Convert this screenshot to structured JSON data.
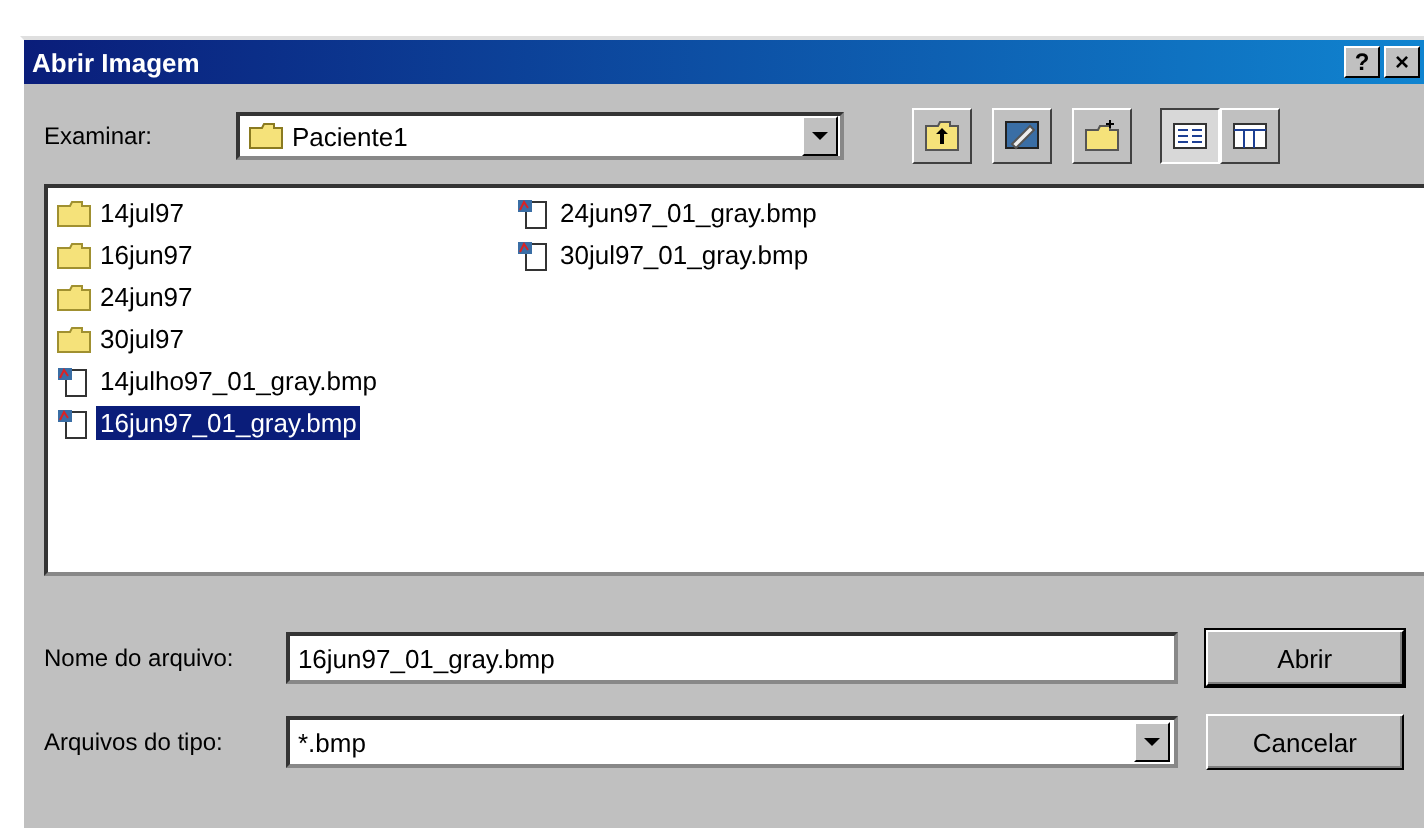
{
  "window": {
    "title": "Abrir Imagem",
    "help_button": "?",
    "close_button": "×"
  },
  "look_in": {
    "label": "Examinar:",
    "value": "Paciente1"
  },
  "toolbar": [
    {
      "kind": "up"
    },
    {
      "kind": "desktop"
    },
    {
      "kind": "newfolder"
    },
    {
      "kind": "list",
      "selected": true
    },
    {
      "kind": "details",
      "selected": false
    }
  ],
  "files": [
    [
      {
        "kind": "folder",
        "name": "14jul97",
        "selected": false
      },
      {
        "kind": "folder",
        "name": "16jun97",
        "selected": false
      },
      {
        "kind": "folder",
        "name": "24jun97",
        "selected": false
      },
      {
        "kind": "folder",
        "name": "30jul97",
        "selected": false
      },
      {
        "kind": "bitmap",
        "name": "14julho97_01_gray.bmp",
        "selected": false
      },
      {
        "kind": "bitmap",
        "name": "16jun97_01_gray.bmp",
        "selected": true
      }
    ],
    [
      {
        "kind": "bitmap",
        "name": "24jun97_01_gray.bmp",
        "selected": false
      },
      {
        "kind": "bitmap",
        "name": "30jul97_01_gray.bmp",
        "selected": false
      }
    ]
  ],
  "file_name": {
    "label": "Nome do arquivo:",
    "value": "16jun97_01_gray.bmp"
  },
  "file_type": {
    "label": "Arquivos do tipo:",
    "value": "*.bmp"
  },
  "buttons": [
    "Abrir",
    "Cancelar"
  ]
}
